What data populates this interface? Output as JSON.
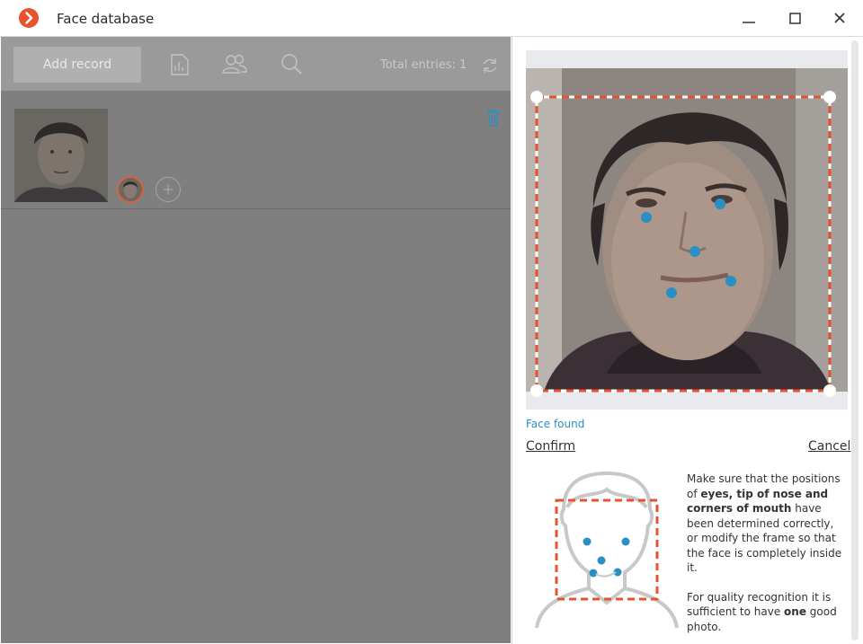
{
  "window": {
    "title": "Face database",
    "accent_color": "#e8522f",
    "controls": {
      "minimize_icon": "minimize-icon",
      "maximize_icon": "maximize-icon",
      "close_icon": "close-icon"
    }
  },
  "toolbar": {
    "add_record_label": "Add record",
    "icons": [
      "report-icon",
      "users-icon",
      "search-icon",
      "refresh-icon"
    ],
    "total_label": "Total entries:",
    "total_count": "1"
  },
  "records": [
    {
      "photos": 1,
      "icons": [
        "trash-icon",
        "add-photo-icon"
      ]
    }
  ],
  "editor": {
    "status": "Face found",
    "confirm_label": "Confirm",
    "cancel_label": "Cancel",
    "status_color": "#2a8fc4",
    "frame_color": "#e8522f",
    "landmark_color": "#2a8fc4",
    "hint": {
      "p1_a": "Make sure that the positions of",
      "p1_b": "eyes, tip of nose and corners of mouth",
      "p1_c": "have been determined correctly, or modify the frame so that the face is completely inside it.",
      "p2_a": "For quality recognition it is sufficient to have",
      "p2_b": "one",
      "p2_c": "good photo."
    }
  }
}
